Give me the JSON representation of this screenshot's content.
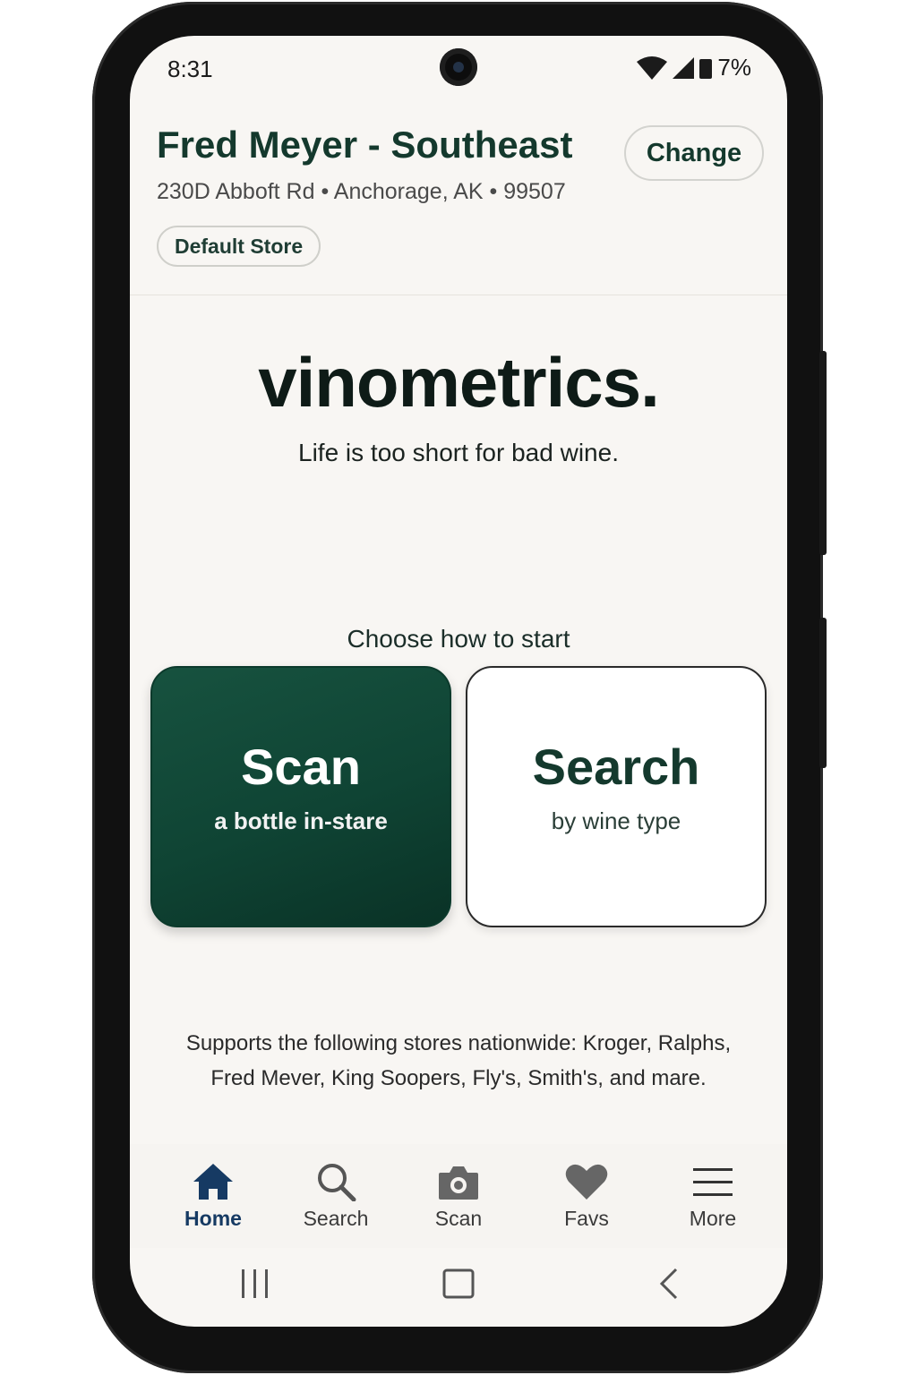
{
  "status": {
    "time": "8:31",
    "battery": "7%"
  },
  "store": {
    "name": "Fred Meyer - Southeast",
    "address": "230D Abboft Rd • Anchorage, AK • 99507",
    "change_label": "Change",
    "badge": "Default Store"
  },
  "brand": {
    "name": "vinometrics.",
    "tagline": "Life is too short for bad wine."
  },
  "start": {
    "heading": "Choose how to start",
    "cards": [
      {
        "title": "Scan",
        "subtitle": "a bottle in-stare"
      },
      {
        "title": "Search",
        "subtitle": "by wine type"
      }
    ]
  },
  "supports": {
    "line1": "Supports the following stores nationwide: Kroger, Ralphs,",
    "line2": "Fred Mever, King Soopers, Fly's, Smith's, and mare."
  },
  "nav": {
    "items": [
      {
        "label": "Home",
        "icon": "home-icon",
        "active": true
      },
      {
        "label": "Search",
        "icon": "search-icon",
        "active": false
      },
      {
        "label": "Scan",
        "icon": "camera-icon",
        "active": false
      },
      {
        "label": "Favs",
        "icon": "heart-icon",
        "active": false
      },
      {
        "label": "More",
        "icon": "menu-icon",
        "active": false
      }
    ]
  },
  "colors": {
    "accent_green": "#14392d",
    "scan_card": "#0f4434",
    "nav_active": "#163a63",
    "background": "#f8f6f3"
  }
}
